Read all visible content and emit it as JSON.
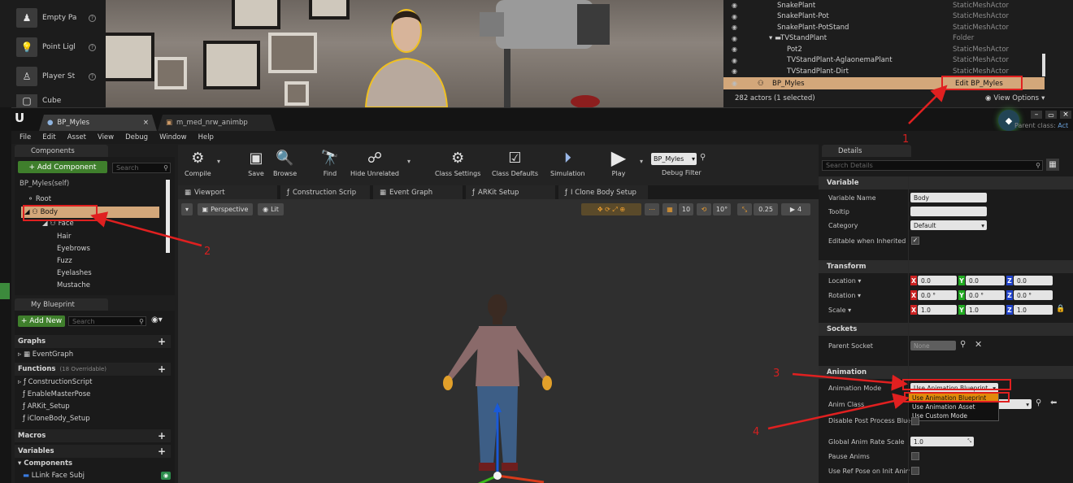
{
  "background_editor": {
    "place_items": [
      {
        "label": "Empty Pa",
        "icon": "empty-actor-icon"
      },
      {
        "label": "Point Ligl",
        "icon": "point-light-icon"
      },
      {
        "label": "Player St",
        "icon": "player-start-icon"
      },
      {
        "label": "Cube",
        "icon": "cube-icon"
      }
    ],
    "outliner": {
      "rows": [
        {
          "name": "SnakePlant",
          "type": "StaticMeshActor"
        },
        {
          "name": "SnakePlant-Pot",
          "type": "StaticMeshActor"
        },
        {
          "name": "SnakePlant-PotStand",
          "type": "StaticMeshActor"
        },
        {
          "name": "TVStandPlant",
          "type": "Folder"
        },
        {
          "name": "Pot2",
          "type": "StaticMeshActor"
        },
        {
          "name": "TVStandPlant-AglaonemaPlant",
          "type": "StaticMeshActor"
        },
        {
          "name": "TVStandPlant-Dirt",
          "type": "StaticMeshActor"
        },
        {
          "name": "BP_Myles",
          "type": "Edit BP_Myles"
        }
      ],
      "status": "282 actors (1 selected)",
      "view_options": "View Options"
    }
  },
  "window": {
    "tabs": [
      {
        "label": "BP_Myles"
      },
      {
        "label": "m_med_nrw_animbp"
      }
    ],
    "parent_class_label": "Parent class:",
    "parent_class_value": "Act"
  },
  "menu": [
    "File",
    "Edit",
    "Asset",
    "View",
    "Debug",
    "Window",
    "Help"
  ],
  "components": {
    "title": "Components",
    "add_button": "+ Add Component",
    "search_placeholder": "Search",
    "self_label": "BP_Myles(self)",
    "tree": [
      "Root",
      "Body",
      "Face",
      "Hair",
      "Eyebrows",
      "Fuzz",
      "Eyelashes",
      "Mustache"
    ]
  },
  "my_blueprint": {
    "title": "My Blueprint",
    "add_button": "+ Add New",
    "search_placeholder": "Search",
    "graphs_label": "Graphs",
    "event_graph": "EventGraph",
    "functions_label": "Functions",
    "functions_count": "(18 Overridable)",
    "functions": [
      "ConstructionScript",
      "EnableMasterPose",
      "ARKit_Setup",
      "iCloneBody_Setup"
    ],
    "macros_label": "Macros",
    "variables_label": "Variables",
    "components_label": "Components",
    "first_variable": "LLink Face Subj"
  },
  "toolbar": {
    "buttons": [
      "Compile",
      "Save",
      "Browse",
      "Find",
      "Hide Unrelated",
      "Class Settings",
      "Class Defaults",
      "Simulation",
      "Play"
    ],
    "debug_object": "BP_Myles",
    "debug_filter": "Debug Filter"
  },
  "editor_tabs": [
    "Viewport",
    "Construction Scrip",
    "Event Graph",
    "ARKit Setup",
    "I Clone Body Setup"
  ],
  "viewport": {
    "perspective": "Perspective",
    "lit": "Lit",
    "grid_snap": "10",
    "rot_snap": "10°",
    "scale_snap": "0.25",
    "cam_speed": "4"
  },
  "details": {
    "title": "Details",
    "search_placeholder": "Search Details",
    "variable_section": "Variable",
    "variable_name_label": "Variable Name",
    "variable_name_value": "Body",
    "tooltip_label": "Tooltip",
    "category_label": "Category",
    "category_value": "Default",
    "editable_inherited_label": "Editable when Inherited",
    "transform_section": "Transform",
    "location_label": "Location",
    "rotation_label": "Rotation",
    "scale_label": "Scale",
    "location": [
      "0.0",
      "0.0",
      "0.0"
    ],
    "rotation": [
      "0.0 °",
      "0.0 °",
      "0.0 °"
    ],
    "scale": [
      "1.0",
      "1.0",
      "1.0"
    ],
    "sockets_section": "Sockets",
    "parent_socket_label": "Parent Socket",
    "parent_socket_value": "None",
    "animation_section": "Animation",
    "animation_mode_label": "Animation Mode",
    "animation_mode_value": "Use Animation Blueprint",
    "anim_class_label": "Anim Class",
    "dropdown_options": [
      "Use Animation Blueprint",
      "Use Animation Asset",
      "Use Custom Mode"
    ],
    "disable_post_label": "Disable Post Process Blue",
    "global_rate_label": "Global Anim Rate Scale",
    "global_rate_value": "1.0",
    "pause_anims_label": "Pause Anims",
    "ref_pose_label": "Use Ref Pose on Init Anim"
  },
  "callouts": [
    "1",
    "2",
    "3",
    "4"
  ],
  "colors": {
    "highlight": "#e02020",
    "accent_green": "#3f7f2c",
    "selection": "#d3a77a"
  }
}
